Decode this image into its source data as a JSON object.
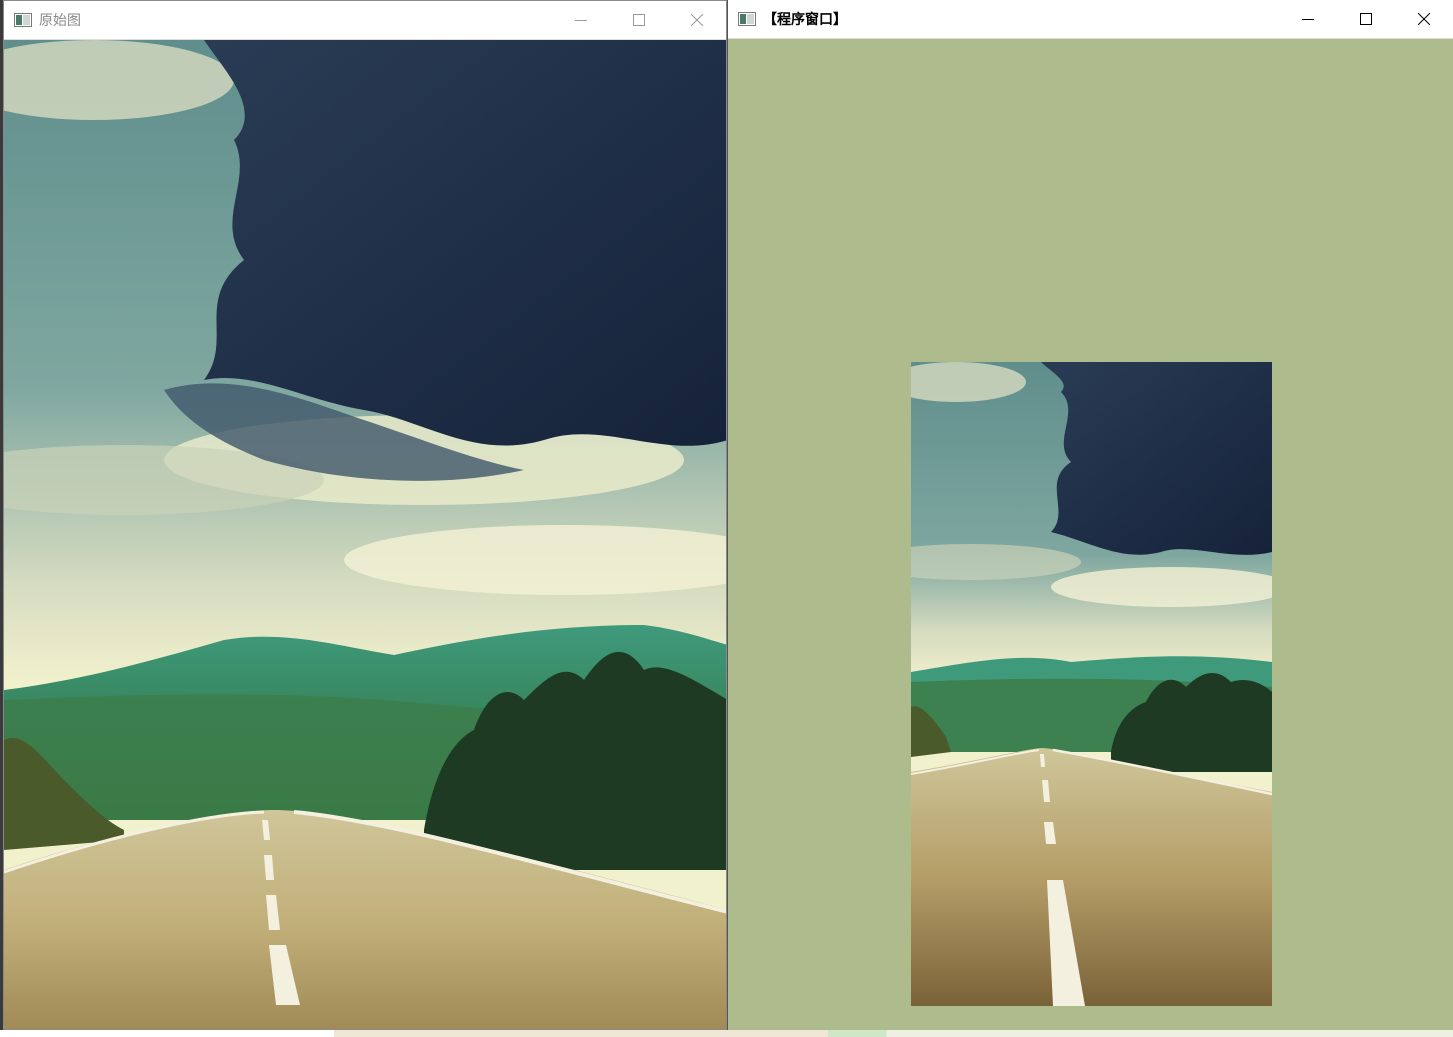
{
  "windows": {
    "original": {
      "title": "原始图",
      "icon": "opencv-window-icon",
      "controls": {
        "minimize": "minimize-icon",
        "maximize": "maximize-icon",
        "close": "close-icon"
      },
      "image": "road-landscape-photo"
    },
    "program": {
      "title": "【程序窗口】",
      "icon": "opencv-window-icon",
      "controls": {
        "minimize": "minimize-icon",
        "maximize": "maximize-icon",
        "close": "close-icon"
      },
      "image": "road-landscape-photo-resized",
      "background_color": "#adbb8d"
    }
  }
}
